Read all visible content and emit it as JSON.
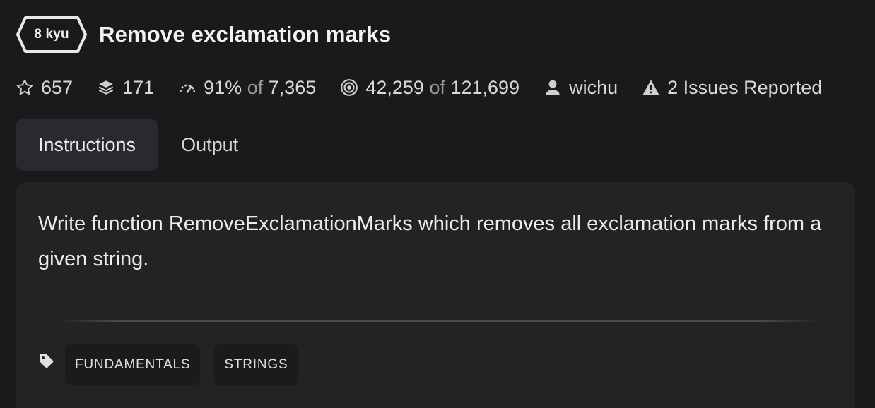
{
  "kata": {
    "rank": "8 kyu",
    "title": "Remove exclamation marks"
  },
  "stats": {
    "stars": "657",
    "collections": "171",
    "satisfaction_percent": "91%",
    "satisfaction_of": "of",
    "satisfaction_votes": "7,365",
    "completed": "42,259",
    "completed_of": "of",
    "attempted": "121,699",
    "author": "wichu",
    "issues": "2 Issues Reported"
  },
  "tabs": [
    {
      "label": "Instructions",
      "active": true
    },
    {
      "label": "Output",
      "active": false
    }
  ],
  "instructions": {
    "description": "Write function RemoveExclamationMarks which removes all exclamation marks from a given string."
  },
  "tags": [
    "FUNDAMENTALS",
    "STRINGS"
  ],
  "colors": {
    "background": "#1a1a1c",
    "panel": "#232326",
    "tab_active": "#2a2a2e",
    "tag_bg": "#1b1b1d",
    "text": "#e6e6e6",
    "muted": "#9a9a9a"
  },
  "icons": {
    "rank": "hexagon-badge",
    "stars": "star-outline-icon",
    "collections": "layers-icon",
    "satisfaction": "gauge-icon",
    "completed": "target-icon",
    "author": "user-icon",
    "issues": "warning-icon",
    "tags": "tag-icon"
  }
}
